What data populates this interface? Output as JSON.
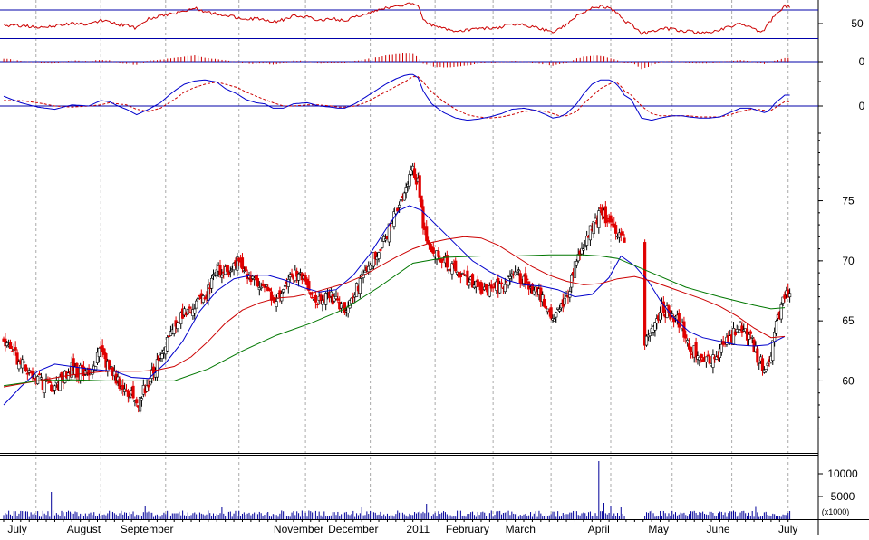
{
  "chart_data": {
    "type": "candlestick",
    "title": "",
    "colors": {
      "up": "#ffffff",
      "down": "#e00000",
      "outline": "#000000",
      "ma_short": "#0000cc",
      "ma_mid": "#cc0000",
      "ma_long": "#007700",
      "rsi": "#cc0000",
      "histogram": "#cc0000",
      "macd": "#0000cc",
      "signal": "#cc0000",
      "volume": "#000099",
      "level": "#0000aa",
      "grid": "#aaaaaa"
    },
    "price_axis": {
      "ylim": [
        54,
        81
      ],
      "ticks": [
        "60",
        "65",
        "70",
        "75"
      ],
      "tick_values": [
        60,
        65,
        70,
        75
      ]
    },
    "rsi_panel": {
      "ylim": [
        20,
        80
      ],
      "level": 50,
      "upper": 70,
      "lower": 30,
      "tick": "50"
    },
    "histogram_panel": {
      "tick": "0"
    },
    "macd_panel": {
      "tick": "0"
    },
    "volume_panel": {
      "ylim": [
        0,
        14000
      ],
      "ticks": [
        "10000",
        "5000"
      ],
      "tick_values": [
        10000,
        5000
      ],
      "unit_label": "(x1000)"
    },
    "x_axis": {
      "labels": [
        "July",
        "August",
        "September",
        "November",
        "December",
        "2011",
        "February",
        "March",
        "April",
        "May",
        "June",
        "July"
      ],
      "label_index": [
        8,
        47,
        84,
        173,
        205,
        243,
        272,
        303,
        349,
        384,
        419,
        460
      ],
      "grid_index": [
        19,
        57,
        95,
        138,
        177,
        215,
        253,
        287,
        321,
        356,
        392,
        427,
        460
      ]
    },
    "anchors": {
      "index": [
        0,
        10,
        20,
        30,
        40,
        50,
        57,
        62,
        67,
        72,
        78,
        85,
        92,
        97,
        102,
        106,
        112,
        118,
        125,
        130,
        137,
        142,
        148,
        153,
        158,
        164,
        170,
        178,
        185,
        192,
        196,
        200,
        206,
        212,
        218,
        224,
        230,
        235,
        238,
        240,
        243,
        246,
        251,
        258,
        265,
        272,
        278,
        285,
        292,
        298,
        305,
        312,
        318,
        322,
        326,
        330,
        336,
        340,
        345,
        350,
        355,
        358,
        360,
        362,
        364,
        368,
        374,
        380,
        385,
        392,
        398,
        402,
        408,
        414,
        420,
        426,
        432,
        438,
        442,
        446,
        448,
        450,
        452,
        455,
        458
      ],
      "close": [
        63.5,
        61.5,
        60.0,
        59.5,
        61.0,
        60.5,
        62.5,
        61.0,
        60.0,
        59.5,
        58.0,
        60.0,
        62.0,
        63.5,
        65.0,
        65.5,
        66.5,
        67.0,
        69.5,
        69.0,
        70.0,
        69.0,
        68.5,
        68.0,
        66.8,
        67.5,
        69.0,
        68.0,
        66.5,
        67.0,
        66.5,
        66.0,
        67.5,
        69.0,
        70.5,
        72.0,
        74.0,
        75.5,
        77.0,
        77.5,
        76.5,
        73.0,
        71.0,
        70.0,
        69.0,
        68.5,
        68.0,
        67.5,
        68.0,
        69.0,
        68.5,
        67.5,
        66.5,
        65.5,
        66.0,
        67.0,
        70.0,
        71.0,
        73.0,
        74.0,
        73.5,
        72.5,
        72.0,
        71.8,
        72.0,
        73.0,
        62.5,
        64.0,
        66.0,
        65.5,
        64.5,
        63.0,
        62.0,
        61.5,
        62.5,
        63.5,
        64.5,
        63.5,
        62.0,
        61.0,
        61.5,
        62.5,
        64.0,
        65.5,
        67.0
      ],
      "rsi": [
        48,
        47,
        46,
        47,
        50,
        49,
        54,
        52,
        49,
        48,
        44,
        56,
        60,
        62,
        64,
        66,
        70,
        64,
        62,
        60,
        58,
        56,
        56,
        55,
        52,
        55,
        60,
        58,
        54,
        56,
        55,
        54,
        58,
        62,
        66,
        70,
        72,
        74,
        76,
        77,
        72,
        56,
        48,
        44,
        40,
        42,
        43,
        44,
        46,
        50,
        48,
        45,
        42,
        40,
        44,
        48,
        60,
        64,
        70,
        72,
        70,
        66,
        64,
        58,
        52,
        50,
        37,
        40,
        44,
        43,
        41,
        40,
        38,
        38,
        42,
        46,
        50,
        46,
        40,
        42,
        48,
        54,
        60,
        66,
        72
      ],
      "hist": [
        0.8,
        0.3,
        -0.2,
        -0.5,
        0.4,
        0.1,
        0.5,
        0.3,
        -0.2,
        -0.6,
        -0.8,
        0.3,
        0.5,
        0.8,
        1.0,
        1.3,
        1.5,
        1.0,
        0.6,
        0.3,
        0.0,
        -0.5,
        -0.6,
        -0.4,
        -0.8,
        -0.3,
        0.3,
        0.1,
        -0.5,
        -0.3,
        -0.4,
        -0.3,
        0.2,
        0.6,
        1.0,
        1.5,
        1.8,
        2.0,
        2.0,
        1.8,
        1.2,
        -0.5,
        -1.2,
        -1.5,
        -1.3,
        -1.0,
        -0.6,
        -0.3,
        0.0,
        0.2,
        0.1,
        -0.4,
        -0.8,
        -1.0,
        -0.7,
        -0.3,
        0.8,
        1.2,
        1.5,
        1.4,
        1.0,
        0.6,
        0.4,
        0.0,
        -0.3,
        -0.2,
        -1.8,
        -1.0,
        0.0,
        0.2,
        0.0,
        -0.3,
        -0.5,
        -0.4,
        -0.1,
        0.2,
        0.4,
        0.1,
        -0.4,
        -0.6,
        -0.4,
        0.0,
        0.3,
        0.6,
        0.9
      ],
      "macd": [
        0.9,
        0.3,
        -0.1,
        -0.3,
        0.1,
        0.0,
        0.5,
        0.4,
        0.0,
        -0.3,
        -0.8,
        -0.3,
        0.3,
        1.0,
        1.6,
        2.0,
        2.3,
        2.4,
        2.2,
        1.6,
        1.1,
        0.6,
        0.3,
        0.2,
        -0.2,
        -0.2,
        0.2,
        0.3,
        0.0,
        -0.1,
        -0.2,
        -0.2,
        0.2,
        0.8,
        1.4,
        2.0,
        2.5,
        2.8,
        2.9,
        2.9,
        2.6,
        1.4,
        0.2,
        -0.6,
        -1.1,
        -1.3,
        -1.2,
        -1.0,
        -0.7,
        -0.3,
        -0.2,
        -0.4,
        -0.8,
        -1.1,
        -1.0,
        -0.7,
        0.2,
        1.1,
        2.0,
        2.4,
        2.4,
        2.2,
        1.9,
        1.5,
        1.0,
        0.6,
        -1.1,
        -1.3,
        -1.1,
        -0.9,
        -0.9,
        -1.0,
        -1.1,
        -1.1,
        -1.0,
        -0.6,
        -0.2,
        -0.2,
        -0.4,
        -0.6,
        -0.5,
        -0.2,
        0.2,
        0.6,
        1.0
      ],
      "signal": [
        0.5,
        0.5,
        0.3,
        0.0,
        -0.1,
        0.0,
        0.1,
        0.3,
        0.2,
        0.1,
        -0.3,
        -0.5,
        -0.2,
        0.3,
        0.8,
        1.3,
        1.7,
        2.0,
        2.2,
        2.0,
        1.7,
        1.3,
        0.9,
        0.6,
        0.3,
        0.0,
        0.0,
        0.1,
        0.1,
        0.0,
        -0.1,
        -0.1,
        0.0,
        0.3,
        0.8,
        1.3,
        1.8,
        2.2,
        2.5,
        2.7,
        2.7,
        2.2,
        1.3,
        0.4,
        -0.3,
        -0.8,
        -1.0,
        -1.1,
        -1.0,
        -0.8,
        -0.5,
        -0.4,
        -0.5,
        -0.7,
        -0.9,
        -0.9,
        -0.5,
        0.2,
        0.9,
        1.6,
        2.0,
        2.2,
        2.1,
        1.8,
        1.4,
        1.0,
        0.0,
        -0.7,
        -0.9,
        -0.9,
        -0.9,
        -0.9,
        -1.0,
        -1.0,
        -1.0,
        -0.8,
        -0.5,
        -0.3,
        -0.3,
        -0.4,
        -0.5,
        -0.4,
        -0.2,
        0.1,
        0.4
      ]
    },
    "gaps": [
      [
        364,
        376
      ]
    ],
    "series": [
      {
        "kind": "moving_average",
        "color": "#0000cc",
        "x": [
          0,
          10,
          20,
          30,
          50,
          65,
          75,
          85,
          95,
          105,
          115,
          125,
          135,
          145,
          155,
          165,
          175,
          185,
          195,
          205,
          215,
          225,
          232,
          238,
          245,
          255,
          265,
          275,
          285,
          295,
          305,
          315,
          325,
          335,
          345,
          355,
          362,
          370,
          378,
          385,
          392,
          398,
          402,
          410,
          420,
          430,
          440,
          448,
          458
        ],
        "y": [
          58.0,
          59.5,
          60.8,
          61.4,
          61.0,
          60.8,
          60.3,
          60.2,
          61.5,
          63.3,
          65.8,
          67.5,
          68.5,
          68.8,
          68.8,
          68.4,
          67.8,
          67.4,
          67.6,
          68.8,
          70.6,
          72.8,
          74.2,
          74.6,
          74.2,
          72.8,
          71.4,
          70.0,
          69.1,
          68.4,
          68.0,
          67.9,
          67.6,
          67.0,
          67.2,
          68.6,
          70.4,
          69.6,
          68.3,
          66.7,
          65.4,
          64.6,
          64.1,
          63.6,
          63.3,
          63.0,
          62.9,
          63.0,
          63.7
        ]
      },
      {
        "kind": "moving_average",
        "color": "#cc0000",
        "x": [
          0,
          20,
          40,
          60,
          80,
          90,
          100,
          110,
          120,
          130,
          140,
          150,
          160,
          170,
          180,
          190,
          200,
          210,
          220,
          230,
          240,
          250,
          260,
          270,
          280,
          290,
          300,
          310,
          320,
          330,
          340,
          350,
          360,
          370,
          380,
          390,
          400,
          410,
          420,
          430,
          440,
          450,
          458
        ],
        "y": [
          59.5,
          60.0,
          60.5,
          60.8,
          60.8,
          60.9,
          61.2,
          62.0,
          63.3,
          64.8,
          65.9,
          66.5,
          66.9,
          67.0,
          67.3,
          67.7,
          68.1,
          68.7,
          69.5,
          70.3,
          71.0,
          71.5,
          71.8,
          72.0,
          71.9,
          71.3,
          70.4,
          69.5,
          68.8,
          68.3,
          68.0,
          68.1,
          68.5,
          68.7,
          68.3,
          67.8,
          67.3,
          66.8,
          66.2,
          65.4,
          64.4,
          63.6,
          63.7
        ]
      },
      {
        "kind": "moving_average",
        "color": "#007700",
        "x": [
          0,
          20,
          40,
          60,
          80,
          100,
          120,
          140,
          160,
          180,
          200,
          220,
          240,
          260,
          280,
          300,
          320,
          340,
          350,
          360,
          380,
          400,
          420,
          440,
          450,
          458
        ],
        "y": [
          59.6,
          60.0,
          60.1,
          60.0,
          60.0,
          60.0,
          61.0,
          62.5,
          63.8,
          64.8,
          66.0,
          67.8,
          69.8,
          70.3,
          70.4,
          70.4,
          70.5,
          70.5,
          70.4,
          70.2,
          69.0,
          67.8,
          67.0,
          66.3,
          66.0,
          66.1
        ]
      },
      {
        "kind": "volume",
        "color": "#000099",
        "base": 1200,
        "spikes": [
          [
            28,
            6000
          ],
          [
            83,
            2800
          ],
          [
            128,
            2600
          ],
          [
            210,
            2600
          ],
          [
            248,
            3400
          ],
          [
            250,
            2700
          ],
          [
            349,
            12800
          ],
          [
            352,
            3600
          ],
          [
            356,
            3000
          ],
          [
            362,
            2600
          ],
          [
            441,
            2700
          ]
        ]
      }
    ]
  }
}
